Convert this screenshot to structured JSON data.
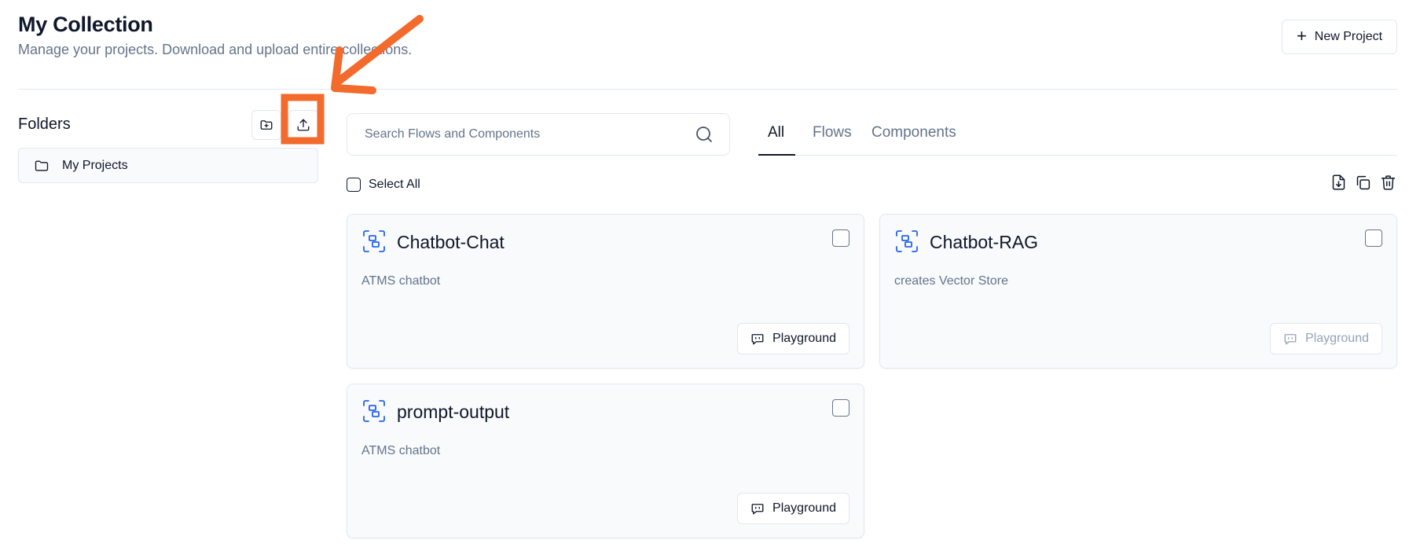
{
  "header": {
    "title": "My Collection",
    "subtitle": "Manage your projects. Download and upload entire collections.",
    "new_project_label": "New Project"
  },
  "sidebar": {
    "title": "Folders",
    "folders": [
      {
        "label": "My Projects"
      }
    ]
  },
  "search": {
    "placeholder": "Search Flows and Components",
    "value": ""
  },
  "tabs": [
    {
      "label": "All",
      "active": true
    },
    {
      "label": "Flows",
      "active": false
    },
    {
      "label": "Components",
      "active": false
    }
  ],
  "toolbar": {
    "select_all_label": "Select All",
    "bulk_actions": [
      "download-icon",
      "duplicate-icon",
      "trash-icon"
    ]
  },
  "cards": [
    {
      "title": "Chatbot-Chat",
      "description": "ATMS chatbot",
      "button_label": "Playground",
      "button_enabled": true
    },
    {
      "title": "Chatbot-RAG",
      "description": "creates Vector Store",
      "button_label": "Playground",
      "button_enabled": false
    },
    {
      "title": "prompt-output",
      "description": "ATMS chatbot",
      "button_label": "Playground",
      "button_enabled": true
    }
  ],
  "colors": {
    "accent_blue": "#2563eb",
    "annotation_orange": "#f26a2c",
    "border": "#e2e8f0",
    "muted_text": "#64748b"
  }
}
